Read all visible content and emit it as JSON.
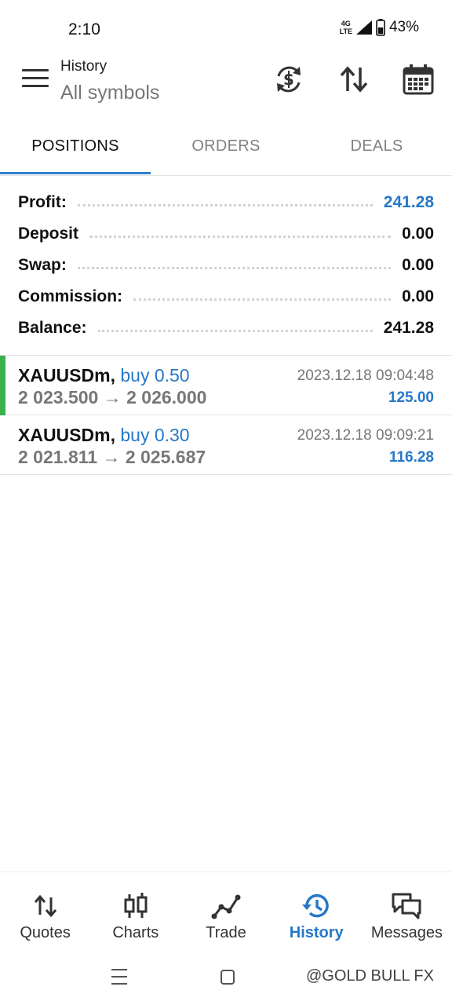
{
  "status_bar": {
    "time": "2:10",
    "network_top": "4G",
    "network_bottom": "LTE",
    "battery": "43%"
  },
  "header": {
    "title": "History",
    "subtitle": "All symbols",
    "icons": [
      "menu-icon",
      "currency-exchange-icon",
      "sort-icon",
      "calendar-icon"
    ]
  },
  "tabs": [
    {
      "label": "POSITIONS",
      "active": true
    },
    {
      "label": "ORDERS",
      "active": false
    },
    {
      "label": "DEALS",
      "active": false
    }
  ],
  "summary": [
    {
      "label": "Profit:",
      "value": "241.28",
      "highlight": true
    },
    {
      "label": "Deposit",
      "value": "0.00",
      "highlight": false
    },
    {
      "label": "Swap:",
      "value": "0.00",
      "highlight": false
    },
    {
      "label": "Commission:",
      "value": "0.00",
      "highlight": false
    },
    {
      "label": "Balance:",
      "value": "241.28",
      "highlight": false
    }
  ],
  "positions": [
    {
      "symbol": "XAUUSDm,",
      "side": "buy 0.50",
      "prices": "2 023.500 → 2 026.000",
      "time": "2023.12.18 09:04:48",
      "profit": "125.00",
      "highlighted": true
    },
    {
      "symbol": "XAUUSDm,",
      "side": "buy 0.30",
      "prices": "2 021.811 → 2 025.687",
      "time": "2023.12.18 09:09:21",
      "profit": "116.28",
      "highlighted": false
    }
  ],
  "bottom_nav": [
    {
      "label": "Quotes",
      "icon": "quotes-icon",
      "active": false
    },
    {
      "label": "Charts",
      "icon": "charts-icon",
      "active": false
    },
    {
      "label": "Trade",
      "icon": "trade-icon",
      "active": false
    },
    {
      "label": "History",
      "icon": "history-icon",
      "active": true
    },
    {
      "label": "Messages",
      "icon": "messages-icon",
      "active": false
    }
  ],
  "watermark": "@GOLD BULL FX",
  "colors": {
    "accent": "#2678c8",
    "tab_indicator": "#2f7fd0",
    "position_bar": "#37b24d",
    "muted_text": "#777777"
  }
}
